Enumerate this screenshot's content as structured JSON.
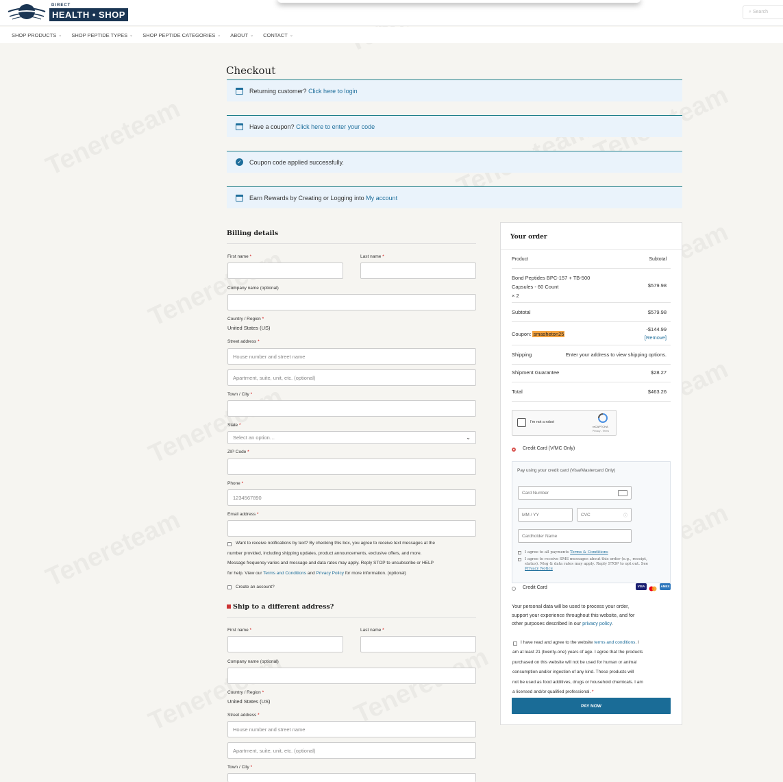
{
  "header": {
    "logo_small": "DIRECT",
    "logo_main": "HEALTH • SHOP",
    "search_placeholder": "Search"
  },
  "nav": [
    {
      "label": "SHOP PRODUCTS"
    },
    {
      "label": "SHOP PEPTIDE TYPES"
    },
    {
      "label": "SHOP PEPTIDE CATEGORIES"
    },
    {
      "label": "ABOUT"
    },
    {
      "label": "CONTACT"
    }
  ],
  "page_title": "Checkout",
  "notices": {
    "returning_text": "Returning customer?",
    "returning_link": "Click here to login",
    "coupon_text": "Have a coupon?",
    "coupon_link": "Click here to enter your code",
    "applied": "Coupon code applied successfully.",
    "rewards_text": "Earn Rewards by Creating or Logging into",
    "rewards_link": "My account"
  },
  "billing": {
    "title": "Billing details",
    "first_name": "First name",
    "last_name": "Last name",
    "company": "Company name (optional)",
    "country_label": "Country / Region",
    "country_value": "United States (US)",
    "street_label": "Street address",
    "street_placeholder": "House number and street name",
    "apt_placeholder": "Apartment, suite, unit, etc. (optional)",
    "town": "Town / City",
    "state_label": "State",
    "state_placeholder": "Select an option…",
    "zip": "ZIP Code",
    "phone": "Phone",
    "phone_placeholder": "1234567890",
    "email": "Email address",
    "sms_text_1": "Want to receive notifications by text? By checking this box, you agree to receive text messages at the",
    "sms_text_2": "number provided, including shipping updates, product announcements, exclusive offers, and more.",
    "sms_text_3": "Message frequency varies and message and data rates may apply. Reply STOP to unsubscribe or HELP",
    "sms_text_4a": "for help. View our",
    "sms_terms": "Terms and Conditions",
    "sms_and": "and",
    "sms_privacy": "Privacy Policy",
    "sms_text_4b": "for more information. (optional)",
    "create_account": "Create an account?",
    "ship_different": "Ship to a different address?",
    "req": "*"
  },
  "order": {
    "title": "Your order",
    "col_product": "Product",
    "col_subtotal": "Subtotal",
    "product_line1": "Bond Peptides BPC-157 + TB-500",
    "product_line2": "Capsules - 60 Count",
    "product_qty": "× 2",
    "product_price": "$579.98",
    "subtotal_label": "Subtotal",
    "subtotal_value": "$579.98",
    "coupon_label": "Coupon:",
    "coupon_code": "smasheton25",
    "coupon_value": "-$144.99",
    "coupon_remove": "[Remove]",
    "shipping_label": "Shipping",
    "shipping_value": "Enter your address to view shipping options.",
    "guarantee_label": "Shipment Guarantee",
    "guarantee_value": "$28.27",
    "total_label": "Total",
    "total_value": "$463.26",
    "captcha_label": "I'm not a robot",
    "captcha_brand": "reCAPTCHA",
    "captcha_sub": "Privacy - Terms",
    "pay_method_1": "Credit Card (V/MC Only)",
    "cc_intro": "Pay using your credit card (Visa/Mastercard Only)",
    "card_number": "Card Number",
    "expiry": "MM / YY",
    "cvc": "CVC",
    "holder": "Cardholder Name",
    "agree_terms_a": "I agree to all payments",
    "agree_terms_link": "Terms & Conditions",
    "agree_sms_1": "I agree to receive SMS messages about this order (e.g., receipt,",
    "agree_sms_2": "status). Msg & data rates may apply. Reply STOP to opt out. See",
    "agree_sms_link": "Privacy Notice",
    "pay_method_2": "Credit Card",
    "card_visa": "VISA",
    "card_amex": "AMEX",
    "privacy_1": "Your personal data will be used to process your order,",
    "privacy_2": "support your experience throughout this website, and for",
    "privacy_3a": "other purposes described in our",
    "privacy_link": "privacy policy",
    "privacy_3b": ".",
    "tc_1a": "I have read and agree to the website",
    "tc_link": "terms and conditions",
    "tc_1b": ". I",
    "tc_2": "am at least 21 (twenty-one) years of age. I agree that the products",
    "tc_3": "purchased on this website will not be used for human or animal",
    "tc_4": "consumption and/or ingestion of any kind. These products will",
    "tc_5": "not be used as food additives, drugs or household chemicals. I am",
    "tc_6": "a licensed and/or qualified professional.",
    "pay_button": "PAY NOW"
  },
  "watermark": "Tenereteam",
  "colors": {
    "brand": "#1a3553",
    "link": "#1e6e9b",
    "button": "#1a6c97",
    "coupon_highlight": "#f4a340"
  }
}
